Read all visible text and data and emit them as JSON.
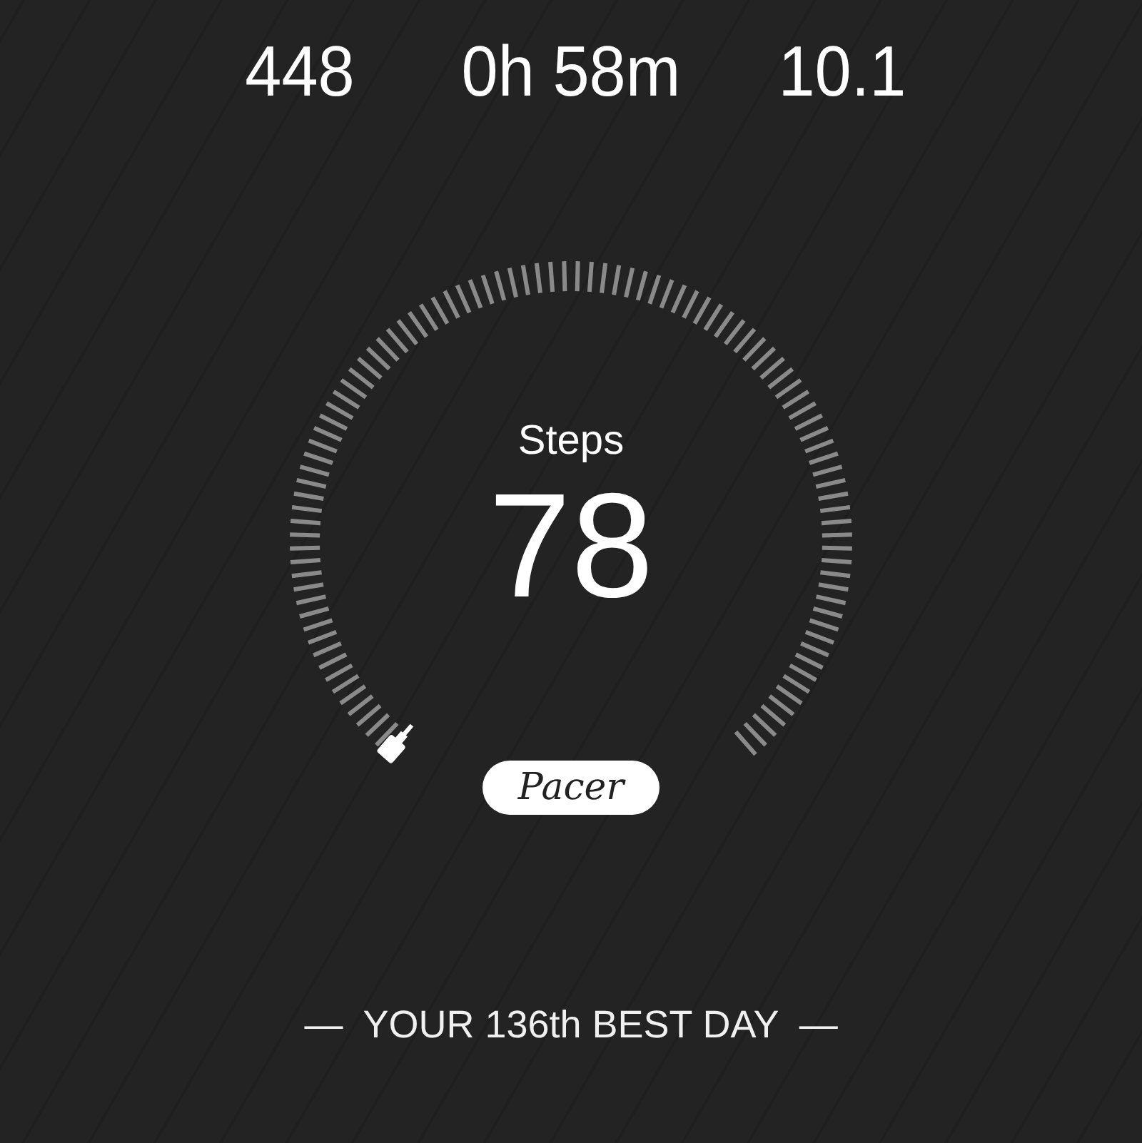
{
  "stats": [
    {
      "value": "448"
    },
    {
      "value": "0h 58m"
    },
    {
      "value": "10.1"
    }
  ],
  "gauge": {
    "label": "Steps",
    "value": "78",
    "brand": "Pacer"
  },
  "best_day": {
    "dash": "—",
    "text": "YOUR 136th BEST DAY"
  }
}
